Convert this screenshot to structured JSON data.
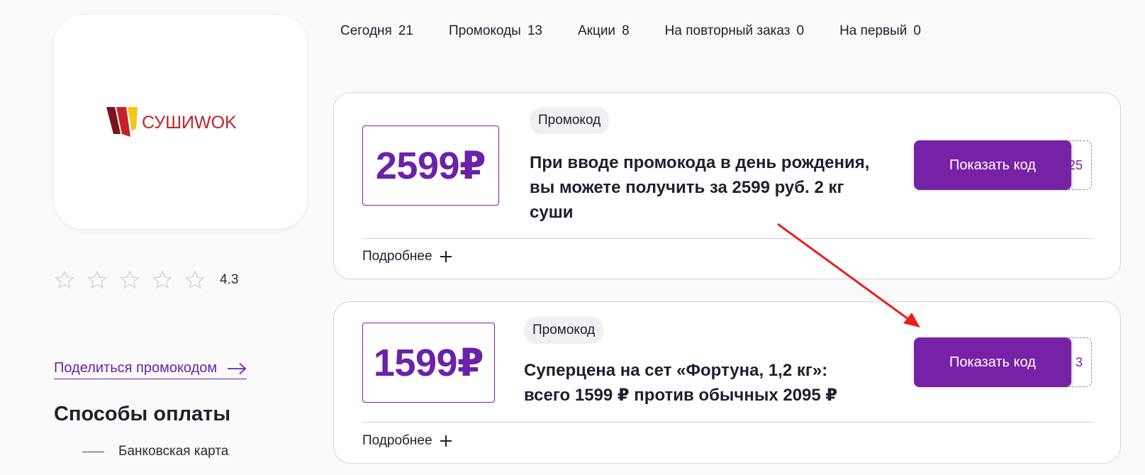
{
  "store": {
    "logo_text": "СУШИWOK",
    "rating_value": "4.3",
    "rating_stars_filled": 0,
    "rating_stars_total": 5,
    "share_label": "Поделиться промокодом",
    "payments_title": "Способы оплаты",
    "payment_methods": [
      "Банковская карта"
    ]
  },
  "tabs": [
    {
      "label": "Сегодня",
      "count": "21"
    },
    {
      "label": "Промокоды",
      "count": "13"
    },
    {
      "label": "Акции",
      "count": "8"
    },
    {
      "label": "На повторный заказ",
      "count": "0"
    },
    {
      "label": "На первый",
      "count": "0"
    }
  ],
  "offers": [
    {
      "price": "2599₽",
      "badge": "Промокод",
      "title": "При вводе промокода в день рождения, вы можете получить за 2599 руб. 2 кг суши",
      "button_label": "Показать код",
      "code_hint": "25",
      "more_label": "Подробнее"
    },
    {
      "price": "1599₽",
      "badge": "Промокод",
      "title": "Суперцена на сет «Фортуна, 1,2 кг»: всего 1599 ₽ против обычных 2095 ₽",
      "button_label": "Показать код",
      "code_hint": "3",
      "more_label": "Подробнее"
    }
  ],
  "colors": {
    "accent": "#7722a6",
    "annotation": "#e8201e",
    "logo_red": "#c8202a",
    "logo_yellow": "#f5c518"
  },
  "icons": [
    "star-icon",
    "arrow-right-icon",
    "plus-icon"
  ]
}
